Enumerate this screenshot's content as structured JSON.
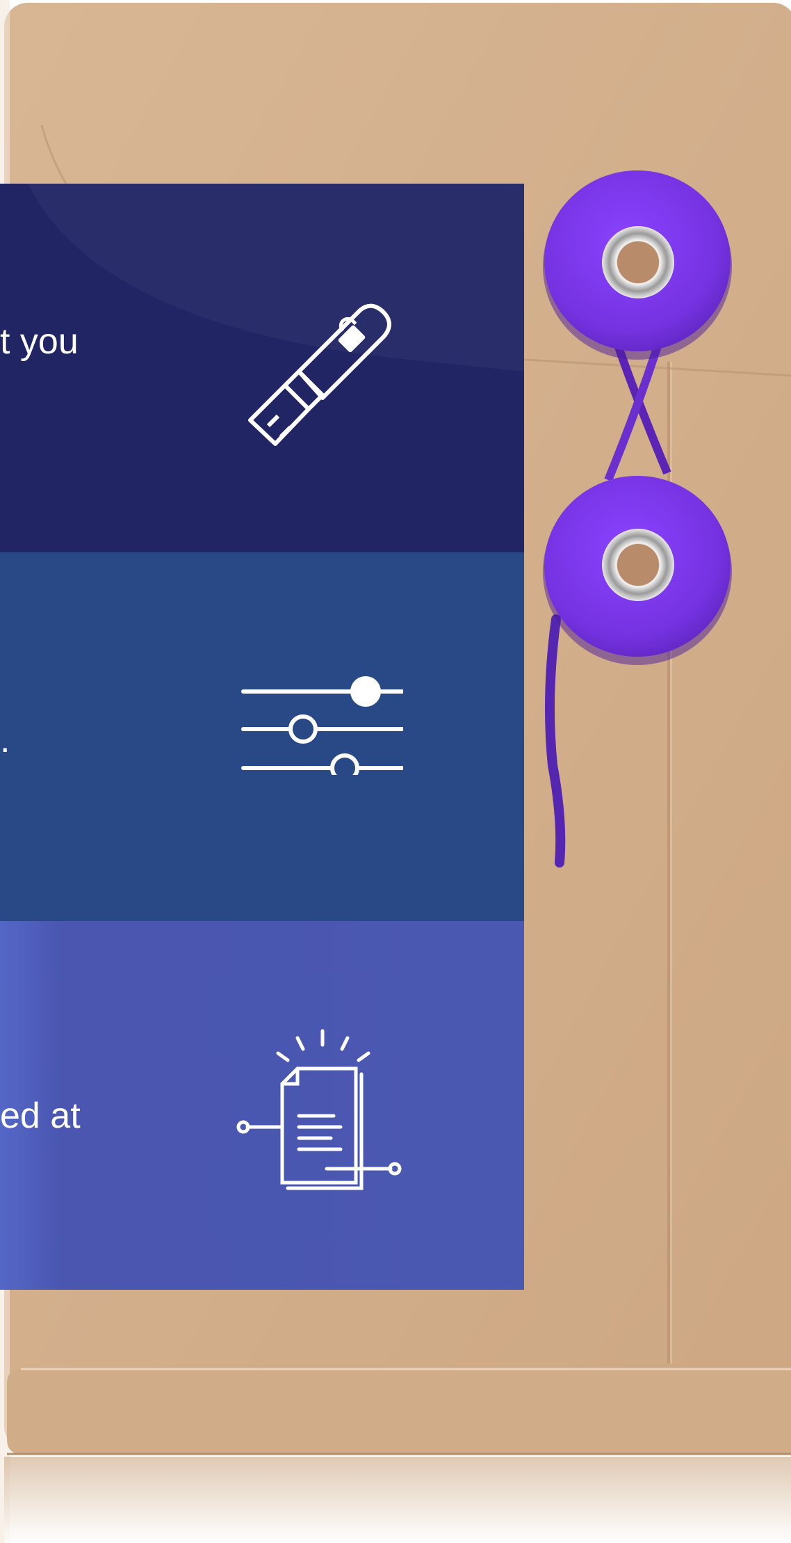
{
  "panels": [
    {
      "text": "t you",
      "icon": "usb-lock-icon"
    },
    {
      "text": ".",
      "icon": "sliders-icon"
    },
    {
      "text": "ed at",
      "icon": "document-flow-icon"
    }
  ],
  "envelope": {
    "button_icon": "eyelet-button-icon",
    "string_icon": "string-tie-icon"
  },
  "colors": {
    "envelope": "#d0ab88",
    "panel_1": "#212563",
    "panel_2": "#294986",
    "panel_3": "#4b58b1",
    "button": "#7a2fe0"
  }
}
